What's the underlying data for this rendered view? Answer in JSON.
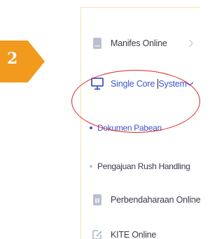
{
  "step_badge": {
    "number": "2",
    "color": "#f19a1e"
  },
  "menu": {
    "items": [
      {
        "label": "Manifes Online",
        "icon": "document-icon",
        "has_chevron": true
      },
      {
        "label": "Single Core System",
        "label_before_cursor": "Single Core ",
        "label_after_cursor": "System",
        "icon": "monitor-icon",
        "has_chevron": true,
        "active": true,
        "accent": "#3d56c7"
      },
      {
        "label": "Perbendaharaan Online",
        "icon": "document-icon",
        "has_chevron": true
      },
      {
        "label": "KITE Online",
        "icon": "edit-icon",
        "has_chevron": false
      }
    ],
    "sub_items": [
      {
        "label": "Dokumen Pabean",
        "active": true,
        "accent": "#3d56c7"
      },
      {
        "label": "Pengajuan Rush Handling",
        "active": false
      }
    ]
  },
  "annotation": {
    "shape": "ellipse",
    "color": "#e02424",
    "target": "Single Core System / Dokumen Pabean"
  }
}
